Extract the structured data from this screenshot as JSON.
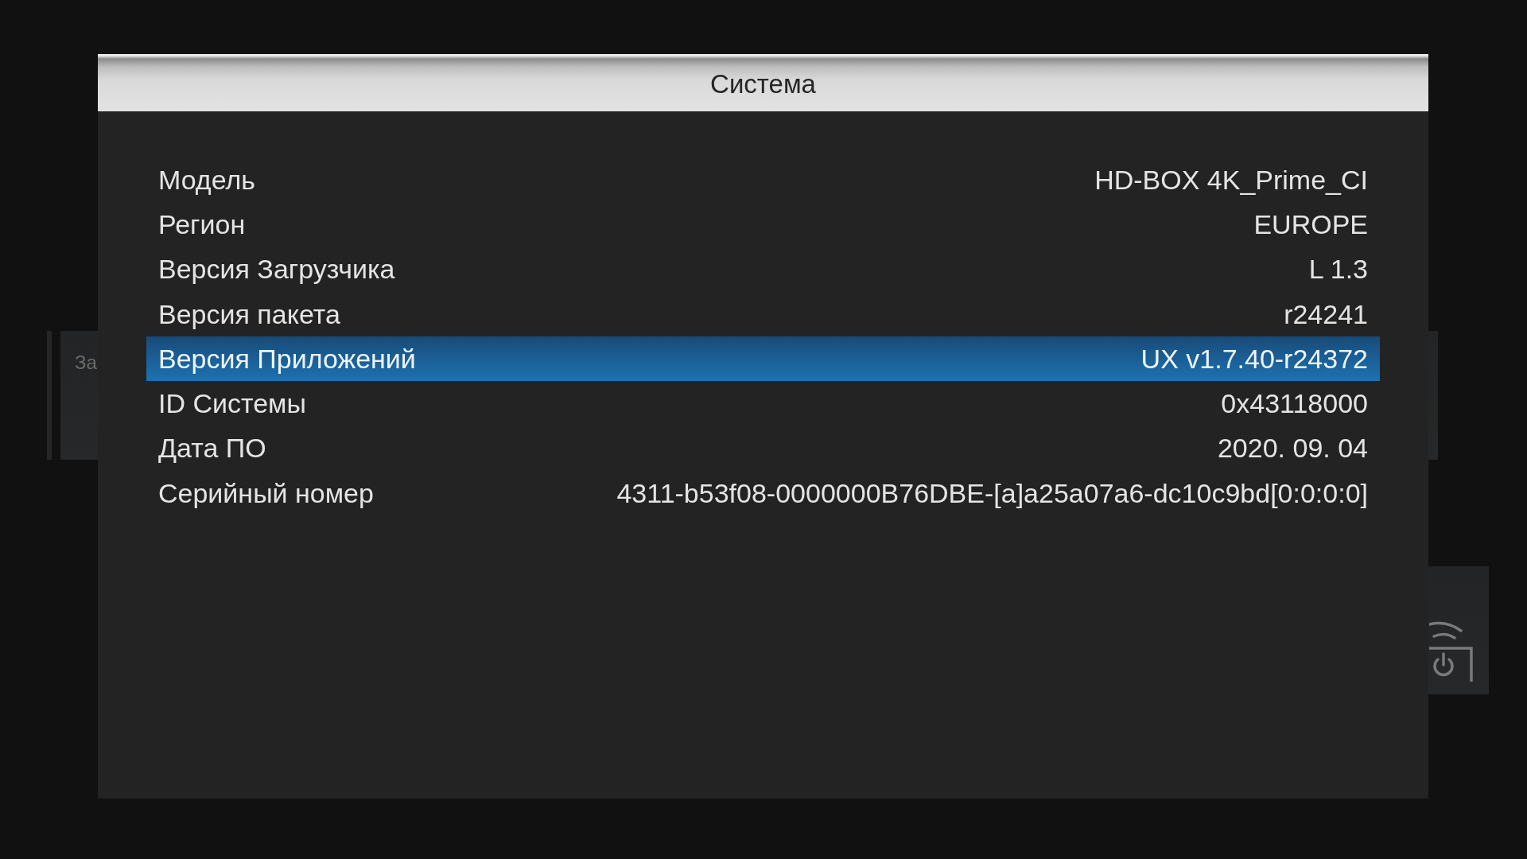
{
  "background": {
    "menu_item": "За"
  },
  "dialog": {
    "title": "Система",
    "rows": [
      {
        "label": "Модель",
        "value": "HD-BOX 4K_Prime_CI",
        "selected": false
      },
      {
        "label": "Регион",
        "value": "EUROPE",
        "selected": false
      },
      {
        "label": "Версия Загрузчика",
        "value": "L 1.3",
        "selected": false
      },
      {
        "label": "Версия пакета",
        "value": "r24241",
        "selected": false
      },
      {
        "label": "Версия Приложений",
        "value": "UX v1.7.40-r24372",
        "selected": true
      },
      {
        "label": "ID Системы",
        "value": "0x43118000",
        "selected": false
      },
      {
        "label": "Дата ПО",
        "value": "2020. 09. 04",
        "selected": false
      },
      {
        "label": "Серийный номер",
        "value": "4311-b53f08-0000000B76DBE-[a]a25a07a6-dc10c9bd[0:0:0:0]",
        "selected": false
      }
    ]
  }
}
